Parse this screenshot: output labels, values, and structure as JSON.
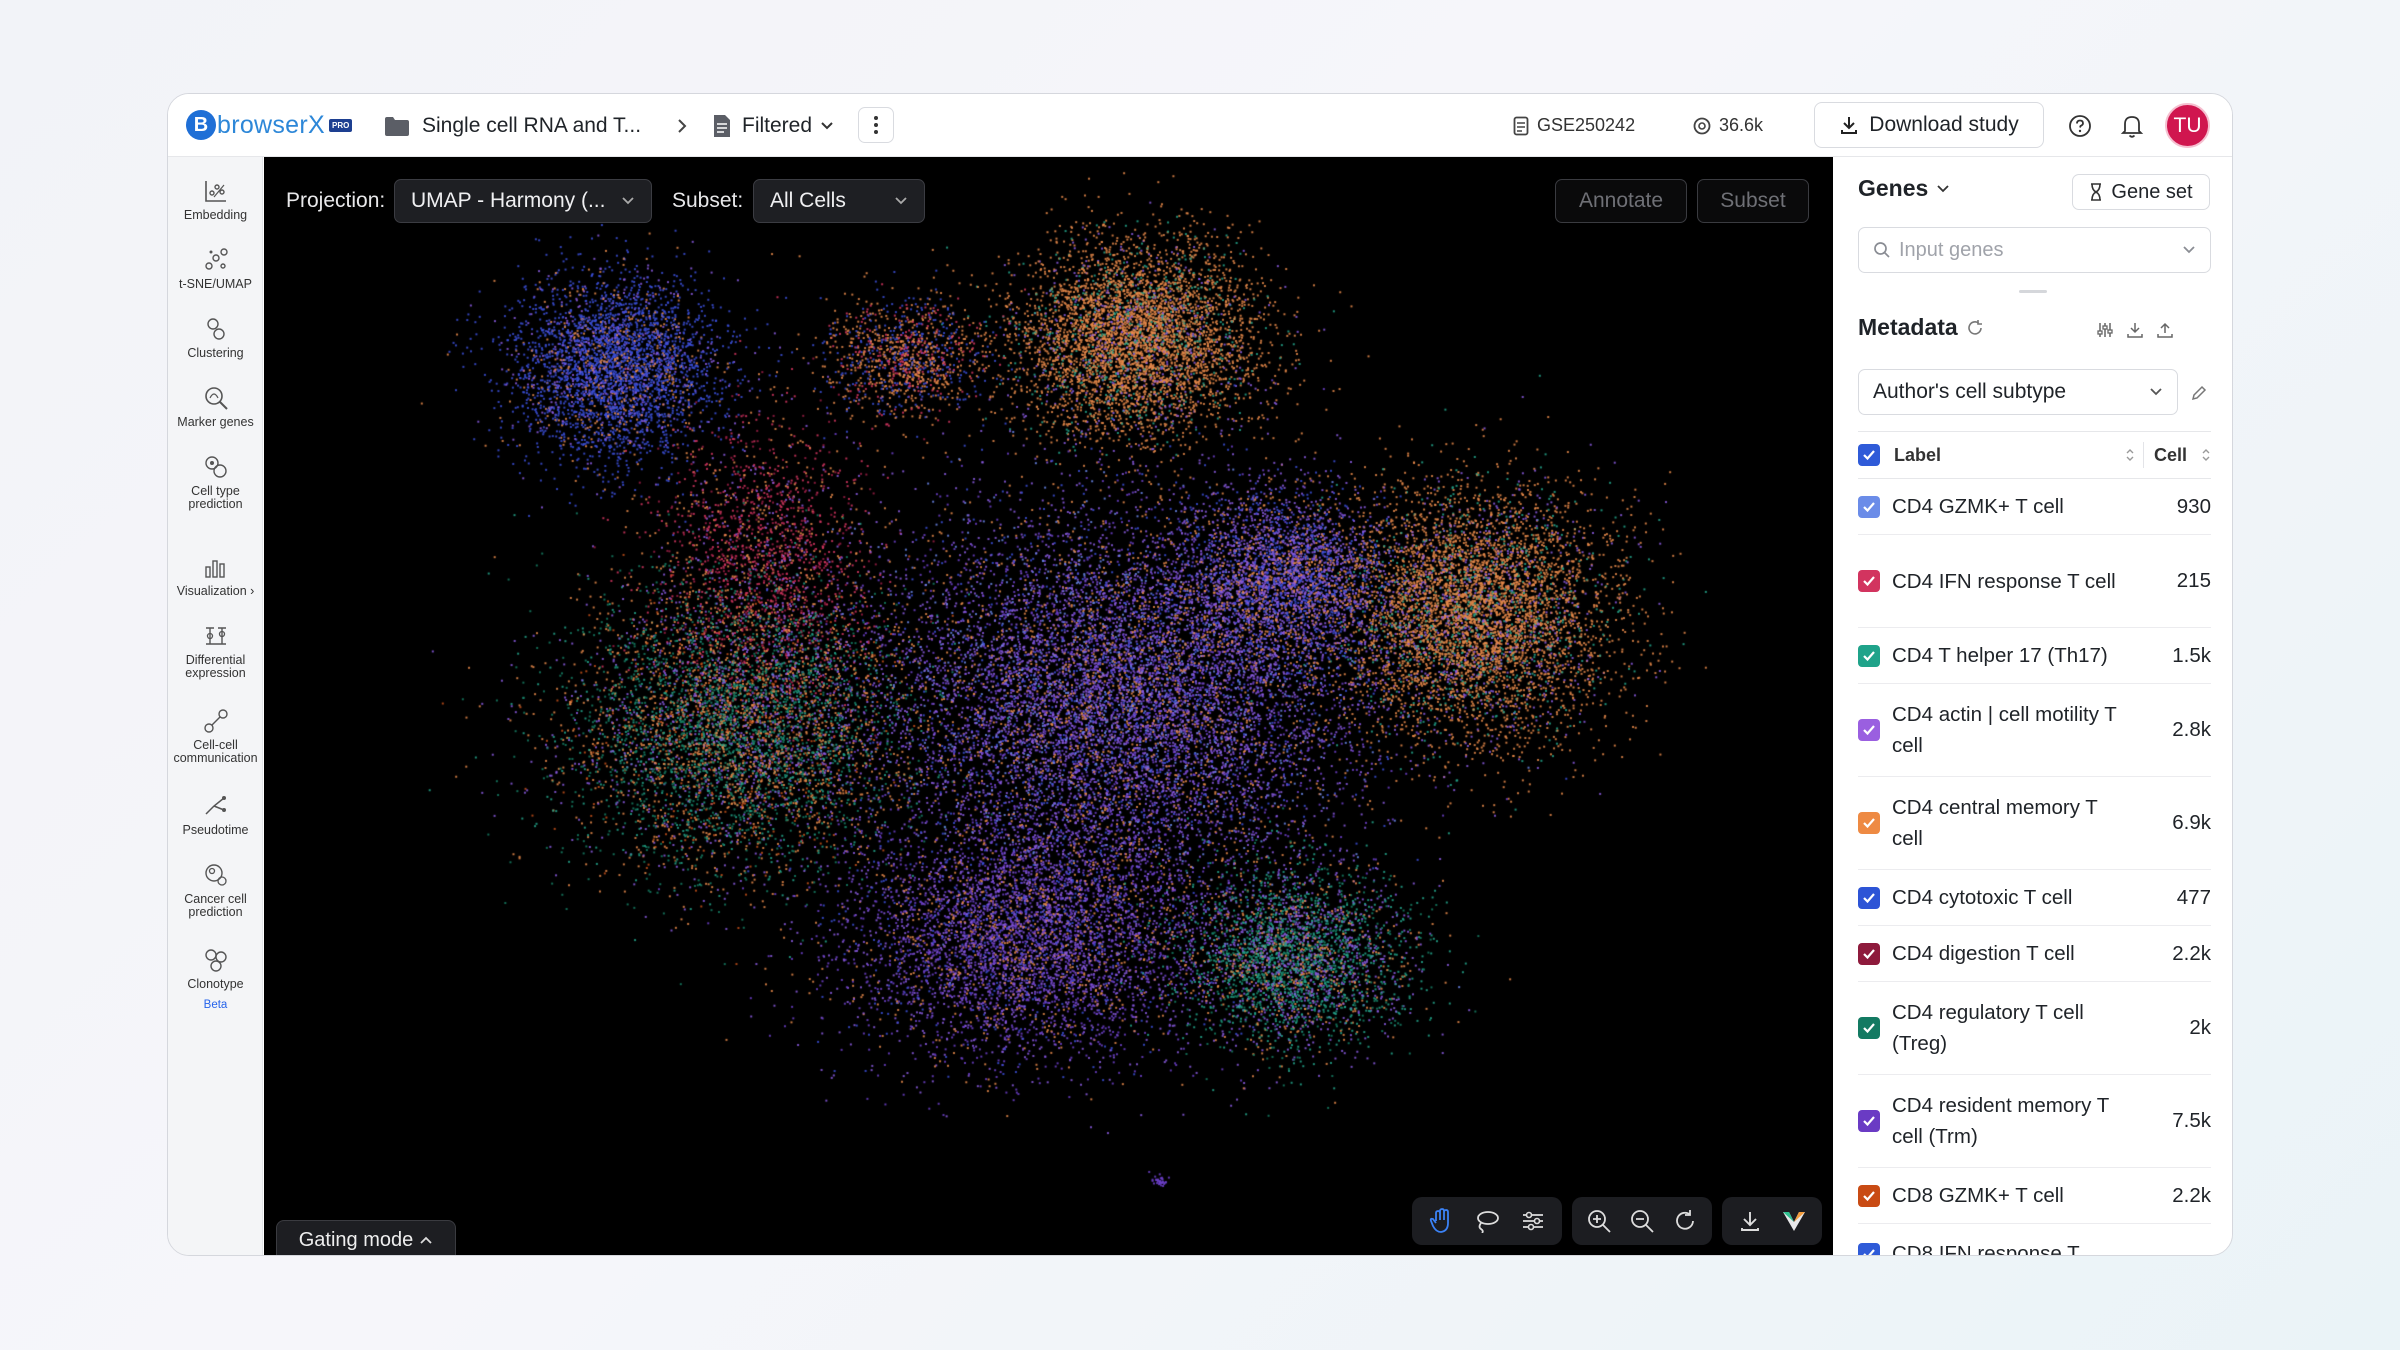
{
  "app": {
    "logo_text": "browserX",
    "logo_badge": "PRO",
    "breadcrumb_study": "Single cell RNA and T...",
    "breadcrumb_filter": "Filtered",
    "study_id": "GSE250242",
    "cell_count": "36.6k",
    "download_label": "Download study",
    "avatar_initials": "TU"
  },
  "sidebar": {
    "items": [
      {
        "label": "Embedding",
        "icon": "embedding-icon"
      },
      {
        "label": "t-SNE/UMAP",
        "icon": "tsne-umap-icon"
      },
      {
        "label": "Clustering",
        "icon": "clustering-icon"
      },
      {
        "label": "Marker genes",
        "icon": "marker-genes-icon"
      },
      {
        "label": "Cell type prediction",
        "icon": "cell-type-prediction-icon"
      },
      {
        "label": "Visualization ›",
        "icon": "visualization-icon"
      },
      {
        "label": "Differential expression",
        "icon": "differential-expression-icon"
      },
      {
        "label": "Cell-cell communication",
        "icon": "cell-communication-icon"
      },
      {
        "label": "Pseudotime",
        "icon": "pseudotime-icon"
      },
      {
        "label": "Cancer cell prediction",
        "icon": "cancer-cell-icon"
      },
      {
        "label": "Clonotype",
        "icon": "clonotype-icon",
        "badge": "Beta"
      }
    ]
  },
  "canvas": {
    "projection_label": "Projection:",
    "projection_value": "UMAP - Harmony (...",
    "subset_label": "Subset:",
    "subset_value": "All Cells",
    "annotate_label": "Annotate",
    "subset_button_label": "Subset",
    "gating_label": "Gating mode",
    "tools": [
      "pan-icon",
      "lasso-icon",
      "settings-sliders-icon",
      "zoom-in-icon",
      "zoom-out-icon",
      "reset-icon",
      "download-icon",
      "brand-icon"
    ]
  },
  "genes_panel": {
    "title": "Genes",
    "gene_set_label": "Gene set",
    "input_placeholder": "Input genes"
  },
  "metadata_panel": {
    "title": "Metadata",
    "selected_field": "Author's cell subtype",
    "col_label": "Label",
    "col_cell": "Cell",
    "header_checkbox_color": "#2f5bd8",
    "rows": [
      {
        "label": "CD4 GZMK+ T cell",
        "count": "930",
        "color": "#6b8ce8"
      },
      {
        "label": "CD4 IFN response T cell",
        "count": "215",
        "color": "#d2345f"
      },
      {
        "label": "CD4 T helper 17 (Th17)",
        "count": "1.5k",
        "color": "#1fa38a"
      },
      {
        "label": "CD4 actin | cell motility T cell",
        "count": "2.8k",
        "color": "#9a5fe0"
      },
      {
        "label": "CD4 central memory T cell",
        "count": "6.9k",
        "color": "#ee8a43"
      },
      {
        "label": "CD4 cytotoxic T cell",
        "count": "477",
        "color": "#2d54d6"
      },
      {
        "label": "CD4 digestion T cell",
        "count": "2.2k",
        "color": "#8e1a3c"
      },
      {
        "label": "CD4 regulatory T cell (Treg)",
        "count": "2k",
        "color": "#137a62"
      },
      {
        "label": "CD4 resident memory T cell (Trm)",
        "count": "7.5k",
        "color": "#6a3bc4"
      },
      {
        "label": "CD8 GZMK+ T cell",
        "count": "2.2k",
        "color": "#c94b14"
      },
      {
        "label": "CD8 IFN response T",
        "count": "",
        "color": "#2f5bd8"
      }
    ]
  }
}
